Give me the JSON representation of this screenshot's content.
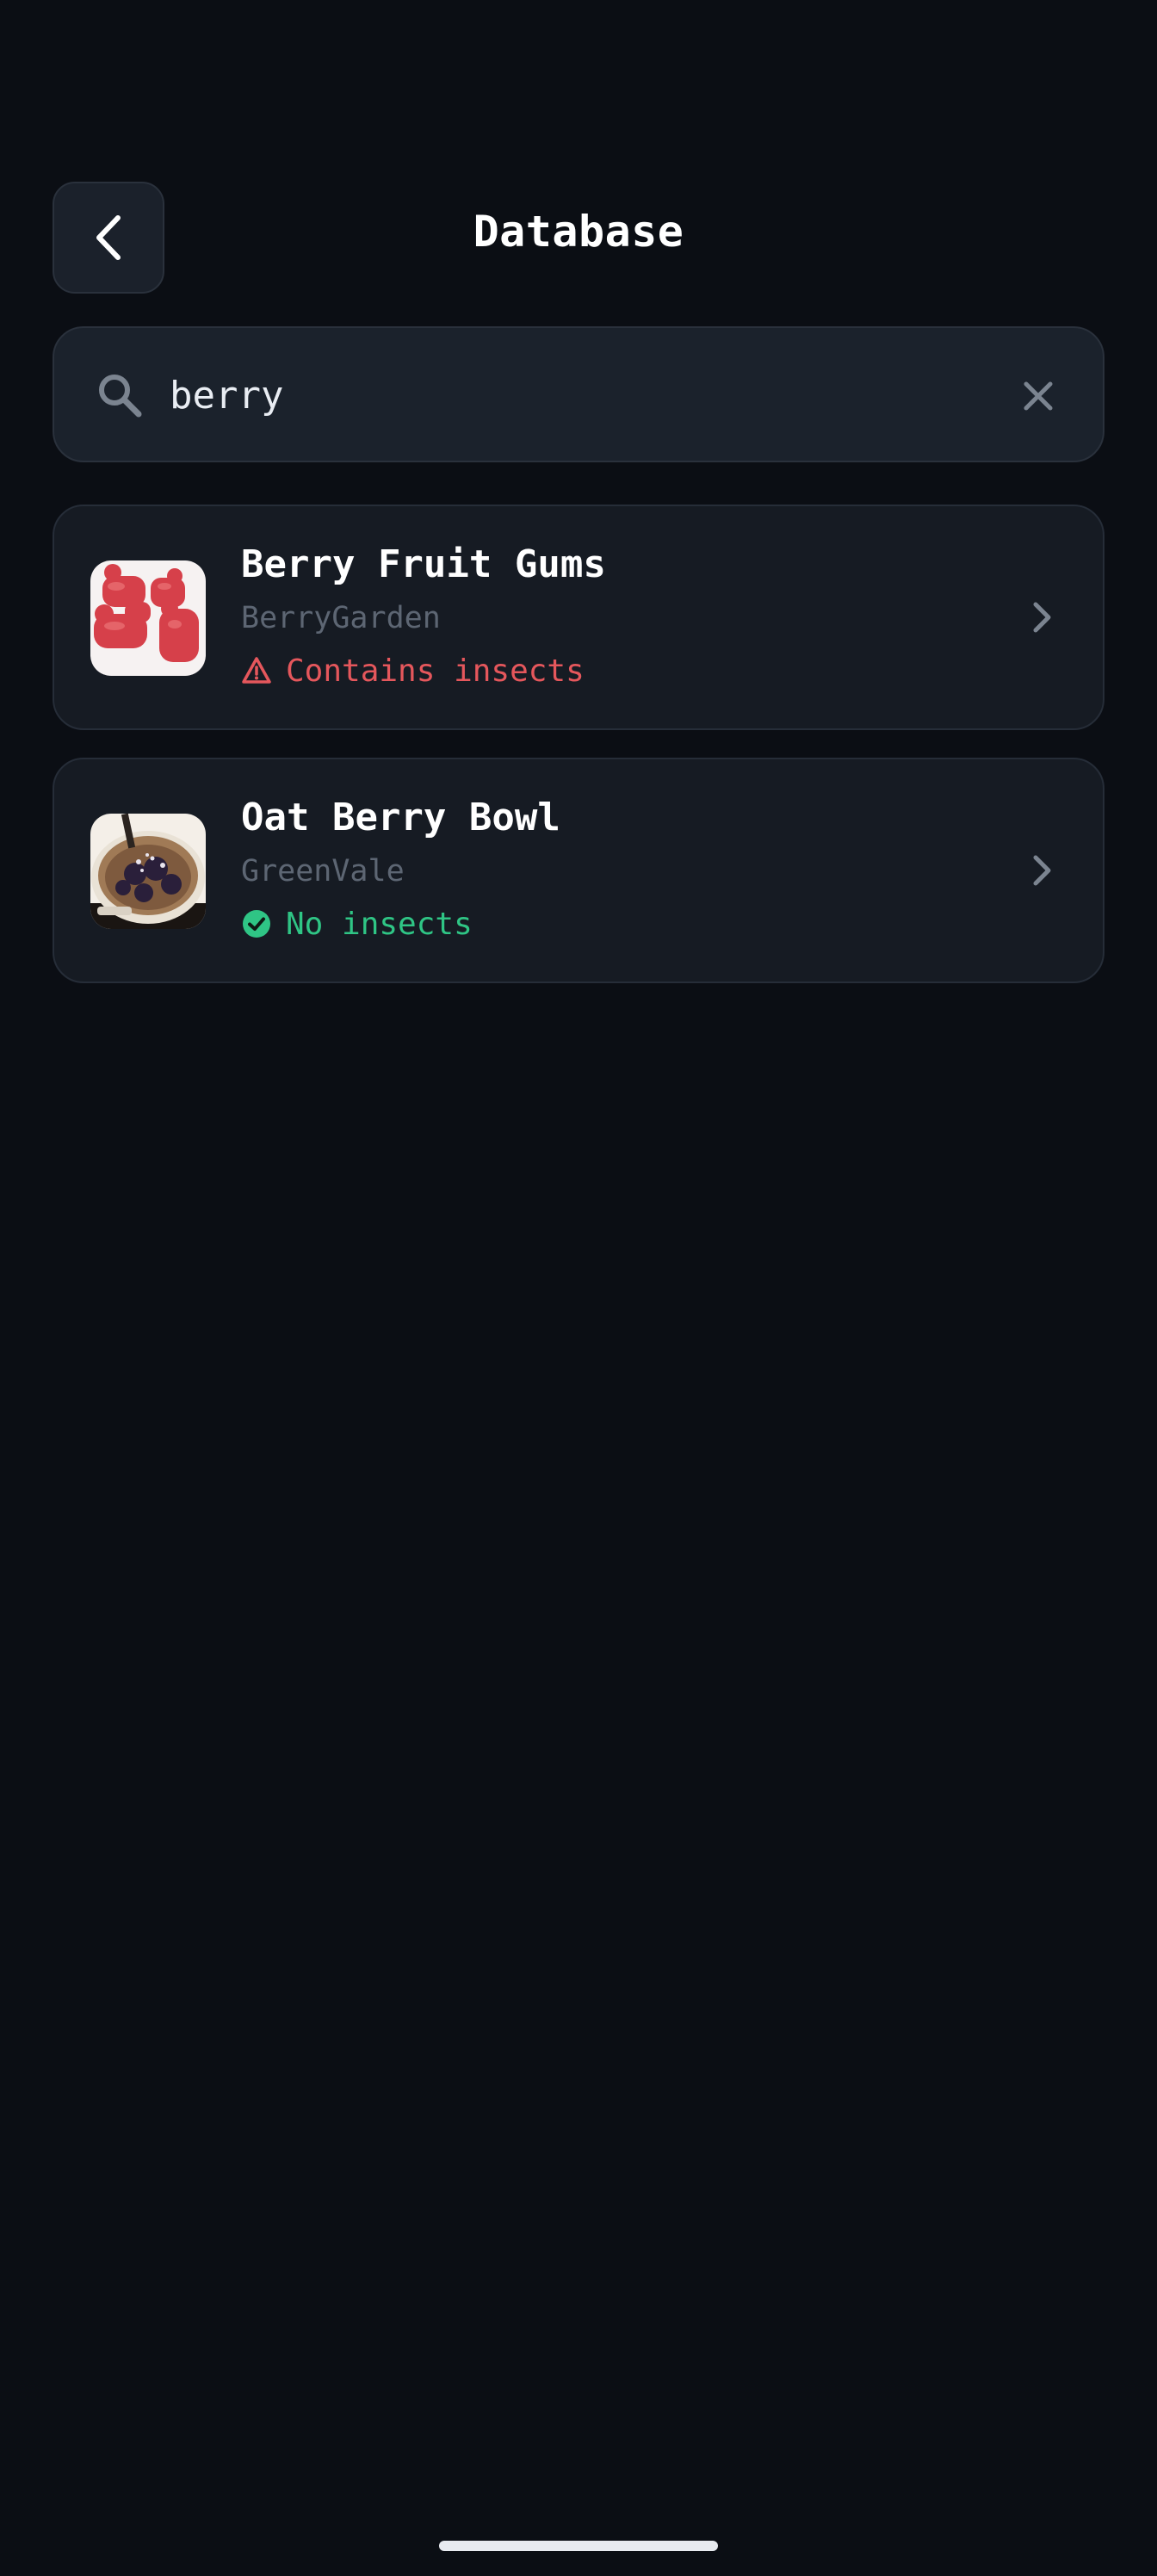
{
  "header": {
    "title": "Database",
    "back_icon": "chevron-left-icon"
  },
  "search": {
    "value": "berry",
    "placeholder": "",
    "search_icon": "search-icon",
    "clear_icon": "close-icon"
  },
  "results": [
    {
      "name": "Berry Fruit Gums",
      "brand": "BerryGarden",
      "status": "Contains insects",
      "status_icon": "warning-triangle-icon",
      "status_color": "#e5575c",
      "thumbnail": "red gummy candies"
    },
    {
      "name": "Oat Berry Bowl",
      "brand": "GreenVale",
      "status": "No insects",
      "status_icon": "check-circle-icon",
      "status_color": "#2fc585",
      "thumbnail": "oat bowl with berries"
    }
  ],
  "colors": {
    "background": "#0b0e14",
    "card": "#161b23",
    "danger": "#e5575c",
    "success": "#2fc585"
  }
}
